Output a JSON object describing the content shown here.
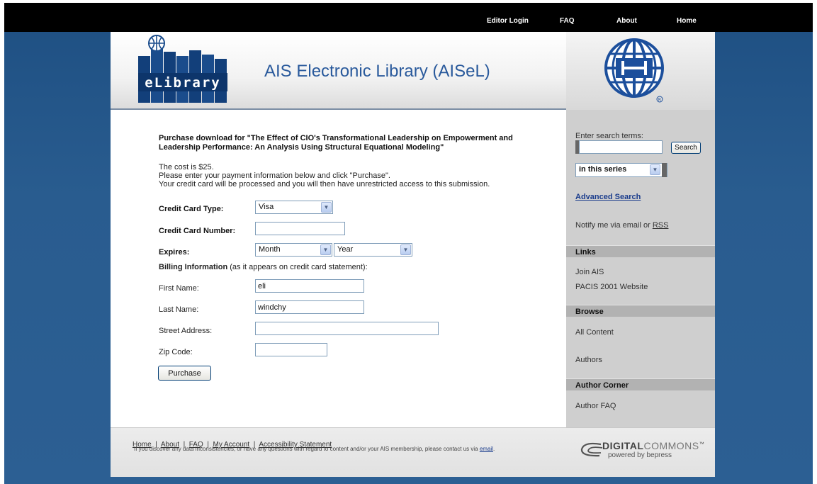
{
  "topnav": {
    "editor_login": "Editor Login",
    "faq": "FAQ",
    "about": "About",
    "home": "Home"
  },
  "header": {
    "logo_text": "eLibrary",
    "site_title": "AIS Electronic Library (AISeL)"
  },
  "purchase": {
    "heading_line1": "Purchase download for \"The Effect of CIO's Transformational Leadership on Empowerment and",
    "heading_line2": "Leadership Performance: An Analysis Using Structural Equational Modeling\"",
    "cost": "The cost is $25.",
    "instructions": "Please enter your payment information below and click \"Purchase\".",
    "access_note": "Your credit card will be processed and you will then have unrestricted access to this submission.",
    "card_type_label": "Credit Card Type:",
    "card_type_value": "Visa",
    "card_number_label": "Credit Card Number:",
    "card_number_value": "",
    "expires_label": "Expires:",
    "expires_month": "Month",
    "expires_year": "Year",
    "billing_label": "Billing Information",
    "billing_note": " (as it appears on credit card statement):",
    "first_name_label": "First Name:",
    "first_name_value": "eli",
    "last_name_label": "Last Name:",
    "last_name_value": "windchy",
    "street_label": "Street Address:",
    "street_value": "",
    "zip_label": "Zip Code:",
    "zip_value": "",
    "purchase_button": "Purchase"
  },
  "sidebar": {
    "search_label": "Enter search terms:",
    "search_value": "",
    "search_button": "Search",
    "scope_value": "in this series",
    "advanced_search": "Advanced Search",
    "notify_text": "Notify me via email or ",
    "rss": "RSS",
    "links_heading": "Links",
    "join_ais": "Join AIS",
    "pacis_website": "PACIS 2001 Website",
    "browse_heading": "Browse",
    "all_content": "All Content",
    "authors": "Authors",
    "author_corner_heading": "Author Corner",
    "author_faq": "Author FAQ"
  },
  "footer": {
    "links": [
      "Home",
      "About",
      "FAQ",
      "My Account",
      "Accessibility Statement"
    ],
    "separator": "|",
    "contact_text": "If you discover any data inconsistencies, or have any questions with regard to content and/or your AIS membership, please contact us via ",
    "email_link": "email",
    "period": ".",
    "dc_brand_bold": "DIGITAL",
    "dc_brand_light": "COMMONS",
    "dc_tm": "™",
    "dc_tagline": "powered by bepress"
  },
  "colors": {
    "background_blue": "#2c5f93",
    "title_blue": "#2a5a9c",
    "link_blue": "#1a3c8c",
    "sidebar_gray": "#cfcfcf"
  }
}
